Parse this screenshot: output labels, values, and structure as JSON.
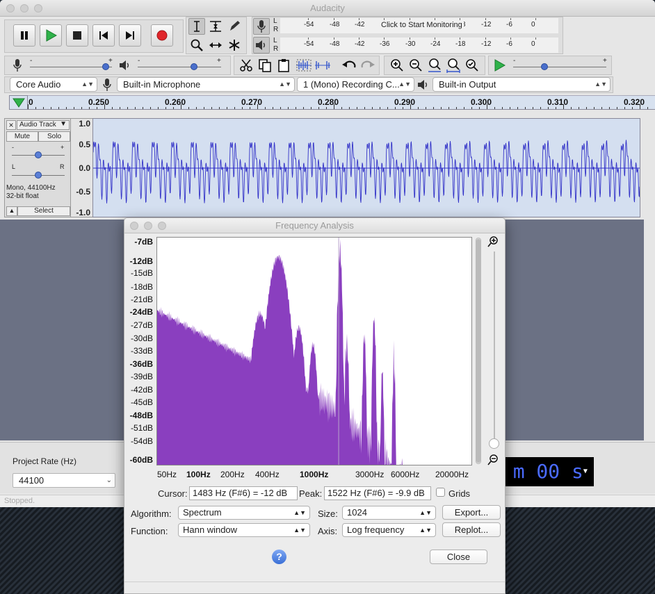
{
  "app": {
    "title": "Audacity",
    "status": "Stopped."
  },
  "meters": {
    "record_hint": "Click to Start Monitoring",
    "ticks": [
      "-54",
      "-48",
      "-42",
      "-36",
      "-30",
      "-24",
      "-18",
      "-12",
      "-6",
      "0"
    ],
    "channel_l": "L",
    "channel_r": "R"
  },
  "devices": {
    "host": "Core Audio",
    "input": "Built-in Microphone",
    "channels": "1 (Mono) Recording C...",
    "output": "Built-in Output"
  },
  "ruler": {
    "labels": [
      "0",
      "0.250",
      "0.260",
      "0.270",
      "0.280",
      "0.290",
      "0.300",
      "0.310",
      "0.320"
    ]
  },
  "track": {
    "name": "Audio Track",
    "close": "×",
    "mute": "Mute",
    "solo": "Solo",
    "minus": "-",
    "plus": "+",
    "left": "L",
    "right": "R",
    "info1": "Mono, 44100Hz",
    "info2": "32-bit float",
    "select": "Select",
    "scale": [
      "1.0",
      "0.5",
      "0.0",
      "-0.5",
      "-1.0"
    ]
  },
  "bottom": {
    "project_rate_label": "Project Rate (Hz)",
    "project_rate": "44100",
    "time_readout": "0 m 00 s"
  },
  "dialog": {
    "title": "Frequency Analysis",
    "db_labels": [
      {
        "t": "-7dB",
        "b": true
      },
      {
        "t": "-12dB",
        "b": true
      },
      {
        "t": "-15dB",
        "b": false
      },
      {
        "t": "-18dB",
        "b": false
      },
      {
        "t": "-21dB",
        "b": false
      },
      {
        "t": "-24dB",
        "b": true
      },
      {
        "t": "-27dB",
        "b": false
      },
      {
        "t": "-30dB",
        "b": false
      },
      {
        "t": "-33dB",
        "b": false
      },
      {
        "t": "-36dB",
        "b": true
      },
      {
        "t": "-39dB",
        "b": false
      },
      {
        "t": "-42dB",
        "b": false
      },
      {
        "t": "-45dB",
        "b": false
      },
      {
        "t": "-48dB",
        "b": true
      },
      {
        "t": "-51dB",
        "b": false
      },
      {
        "t": "-54dB",
        "b": false
      },
      {
        "t": "-60dB",
        "b": true
      }
    ],
    "hz_labels": [
      {
        "t": "50Hz",
        "b": false
      },
      {
        "t": "100Hz",
        "b": true
      },
      {
        "t": "200Hz",
        "b": false
      },
      {
        "t": "400Hz",
        "b": false
      },
      {
        "t": "1000Hz",
        "b": true
      },
      {
        "t": "3000Hz",
        "b": false
      },
      {
        "t": "6000Hz",
        "b": false
      },
      {
        "t": "20000Hz",
        "b": false
      }
    ],
    "cursor_label": "Cursor:",
    "cursor_value": "1483 Hz (F#6) = -12 dB",
    "peak_label": "Peak:",
    "peak_value": "1522 Hz (F#6) = -9.9 dB",
    "grids_label": "Grids",
    "algorithm_label": "Algorithm:",
    "algorithm": "Spectrum",
    "size_label": "Size:",
    "size": "1024",
    "function_label": "Function:",
    "function": "Hann window",
    "axis_label": "Axis:",
    "axis": "Log frequency",
    "export": "Export...",
    "replot": "Replot...",
    "close": "Close",
    "help": "?"
  },
  "colors": {
    "spectrum": "#8a3fbf",
    "wave": "#3232c8",
    "accent": "#4a6fcc"
  }
}
